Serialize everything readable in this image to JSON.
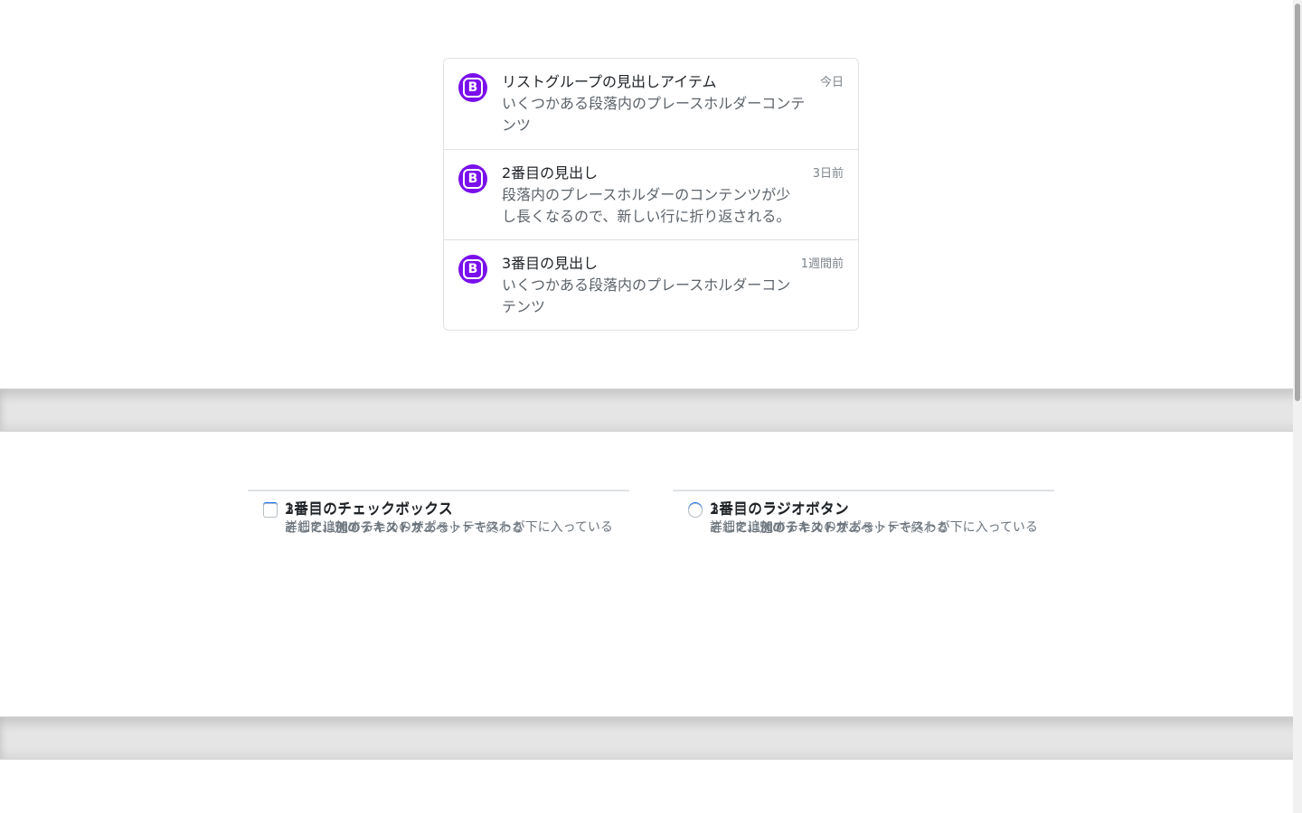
{
  "list_group": {
    "items": [
      {
        "title": "リストグループの見出しアイテム",
        "description": "いくつかある段落内のプレースホルダーコンテンツ",
        "time": "今日",
        "avatar_letter": "B"
      },
      {
        "title": "2番目の見出し",
        "description": "段落内のプレースホルダーのコンテンツが少し長くなるので、新しい行に折り返される。",
        "time": "3日前",
        "avatar_letter": "B"
      },
      {
        "title": "3番目の見出し",
        "description": "いくつかある段落内のプレースホルダーコンテンツ",
        "time": "1週間前",
        "avatar_letter": "B"
      }
    ]
  },
  "checkbox_group": {
    "items": [
      {
        "label": "1番目のチェックボックス",
        "help": "詳細を追加するためのサポートテキストが下に入っている",
        "checked": true
      },
      {
        "label": "2番目のチェックボックス",
        "help": "ここには他のテキストがある",
        "checked": false
      },
      {
        "label": "3番目のチェックボックス",
        "help": "そして、別のテキストスニペットで終わる",
        "checked": false
      }
    ]
  },
  "radio_group": {
    "items": [
      {
        "label": "1番目のラジオボタン",
        "help": "詳細を追加するためのサポートテキストが下に入っている",
        "checked": true
      },
      {
        "label": "2番目のラジオボタン",
        "help": "ここには他のテキストがある",
        "checked": false
      },
      {
        "label": "3番目のラジオボタン",
        "help": "そして、別のテキストスニペットで終わる",
        "checked": false
      }
    ]
  },
  "colors": {
    "avatar": "#7a10ec",
    "accent": "#0d6efd"
  },
  "icons": {
    "avatar": "bootstrap-logo-icon",
    "checkmark": "checkmark-icon"
  }
}
